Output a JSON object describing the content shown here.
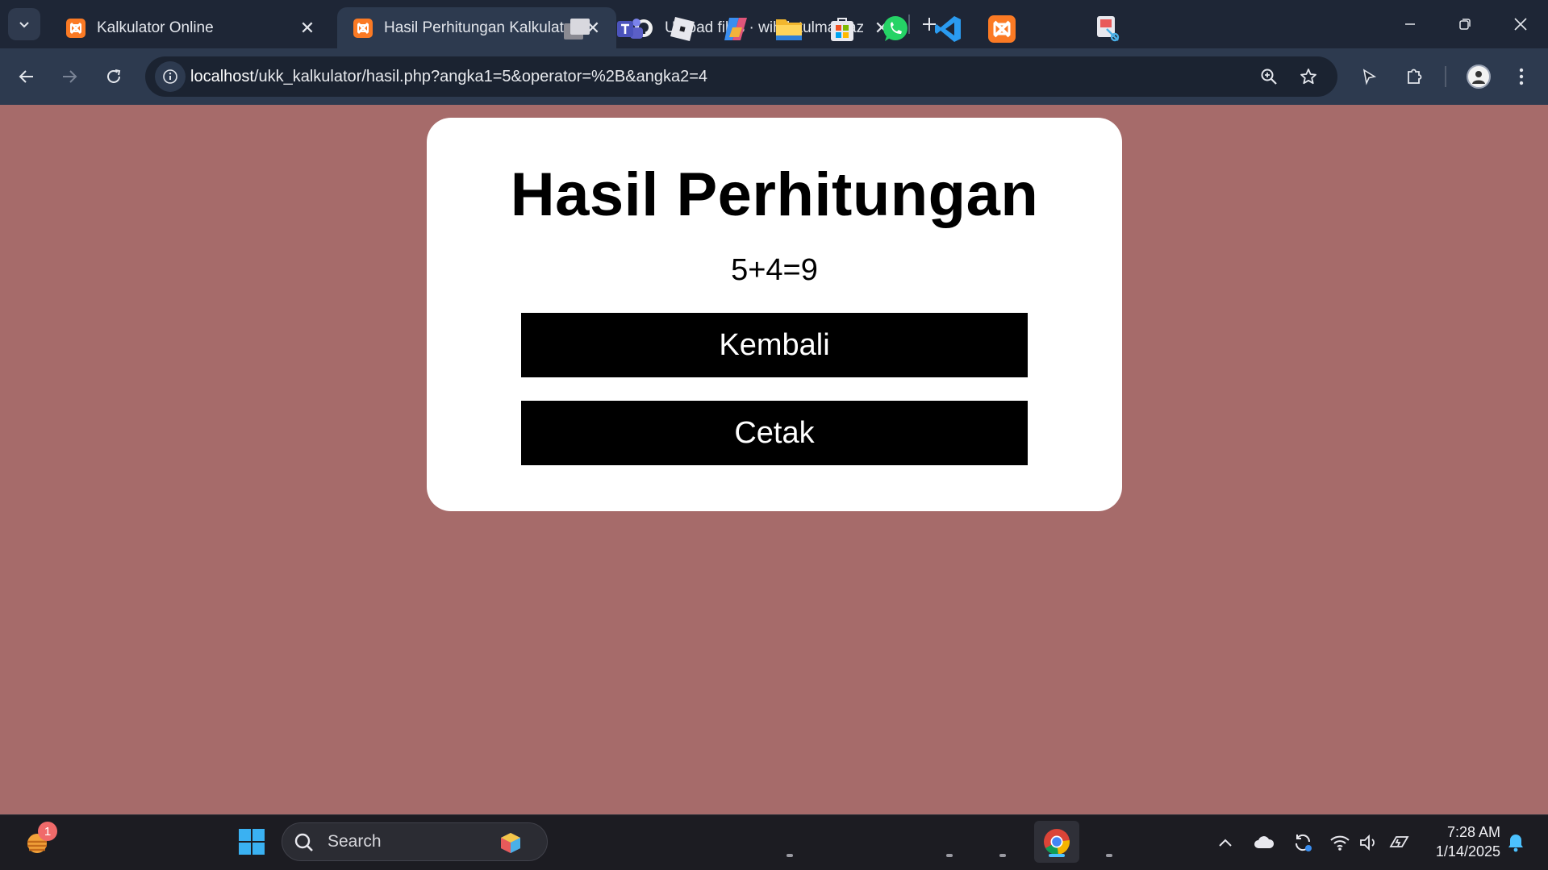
{
  "browser": {
    "tabs": [
      {
        "title": "Kalkulator Online",
        "active": false,
        "icon": "xampp-icon"
      },
      {
        "title": "Hasil Perhitungan Kalkulator Or",
        "active": true,
        "icon": "xampp-icon"
      },
      {
        "title": "Upload files · wihdatulmaulazul",
        "active": false,
        "icon": "github-icon"
      }
    ],
    "address": {
      "host": "localhost",
      "path": "/ukk_kalkulator/hasil.php?angka1=5&operator=%2B&angka2=4"
    }
  },
  "page": {
    "heading": "Hasil Perhitungan",
    "result": "5+4=9",
    "back_label": "Kembali",
    "print_label": "Cetak",
    "background_color": "#a66b6a"
  },
  "taskbar": {
    "search_placeholder": "Search",
    "notification_count": "1",
    "time": "7:28 AM",
    "date": "1/14/2025"
  }
}
